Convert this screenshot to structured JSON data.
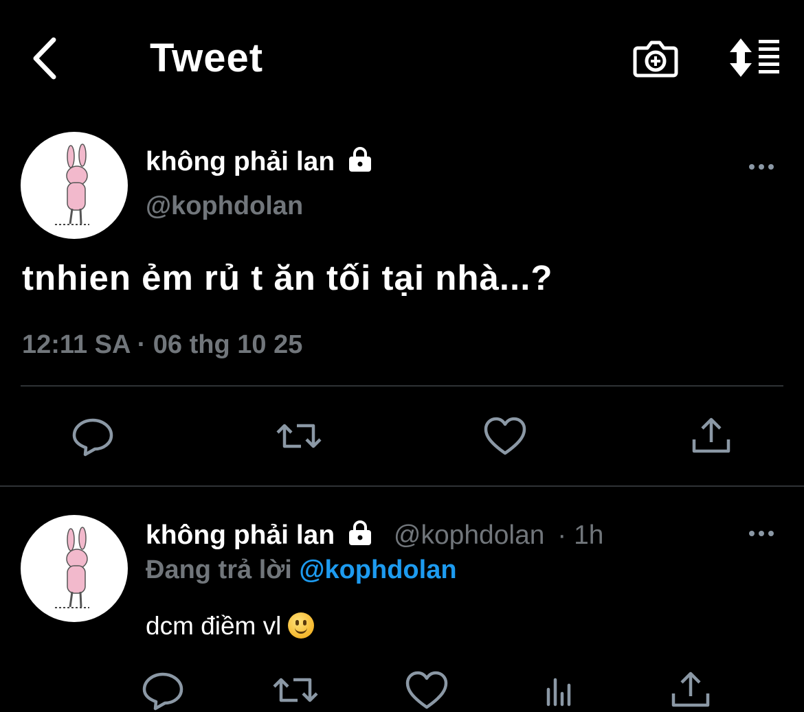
{
  "header": {
    "title": "Tweet"
  },
  "main_tweet": {
    "display_name": "không phải lan",
    "handle": "@kophdolan",
    "text": "tnhien ẻm rủ t ăn tối tại nhà...?",
    "timestamp": "12:11 SA · 06 thg 10 25"
  },
  "reply": {
    "display_name": "không phải lan",
    "handle": "@kophdolan",
    "age": "· 1h",
    "replying_prefix": "Đang trả lời",
    "replying_to": "@kophdolan",
    "text": "dcm điềm vl"
  },
  "icons": {
    "back": "chevron-left-icon",
    "camera": "camera-plus-icon",
    "sort": "sort-icon",
    "lock": "lock-icon",
    "more": "more-horizontal-icon",
    "reply": "comment-icon",
    "retweet": "retweet-icon",
    "like": "heart-icon",
    "share": "share-icon",
    "analytics": "analytics-icon",
    "emoji": "slightly-smiling-face-emoji"
  },
  "colors": {
    "background": "#000000",
    "text": "#ffffff",
    "muted": "#71767b",
    "accent": "#1d9bf0",
    "icon": "#8b98a5"
  }
}
